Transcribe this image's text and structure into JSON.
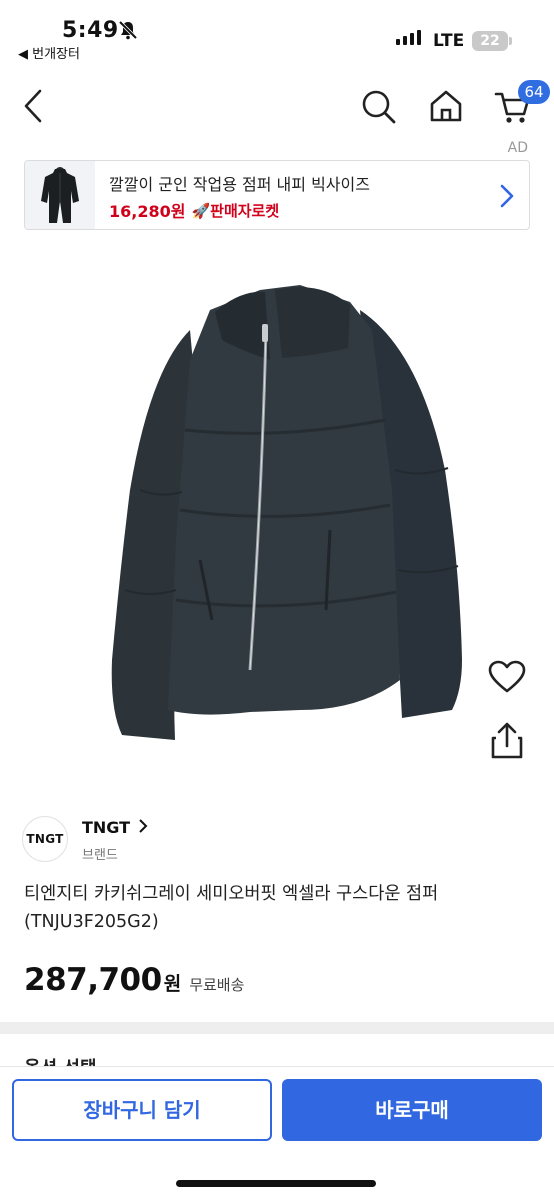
{
  "status_bar": {
    "time": "5:49",
    "back_app": "◀ 번개장터",
    "network": "LTE",
    "battery": "22"
  },
  "nav": {
    "cart_count": "64",
    "icons": [
      "back-chevron-icon",
      "search-icon",
      "home-icon",
      "cart-icon"
    ]
  },
  "ad": {
    "tag": "AD",
    "title": "깔깔이 군인 작업용 점퍼 내피 빅사이즈",
    "price": "16,280원",
    "rocket_label": "🚀판매자로켓"
  },
  "actions": {
    "icons": [
      "heart-icon",
      "share-icon"
    ]
  },
  "brand": {
    "logo": "TNGT",
    "name": "TNGT",
    "sub": "브랜드"
  },
  "product": {
    "title": "티엔지티 카키쉬그레이 세미오버핏 엑셀라 구스다운 점퍼 (TNJU3F205G2)",
    "price": "287,700",
    "currency": "원",
    "shipping": "무료배송"
  },
  "section_peek": "옵션 선택",
  "bottom": {
    "cart_button": "장바구니 담기",
    "buy_button": "바로구매"
  },
  "colors": {
    "accent": "#3167e0",
    "ad_price": "#d0021b",
    "jacket": "#2f383e"
  }
}
